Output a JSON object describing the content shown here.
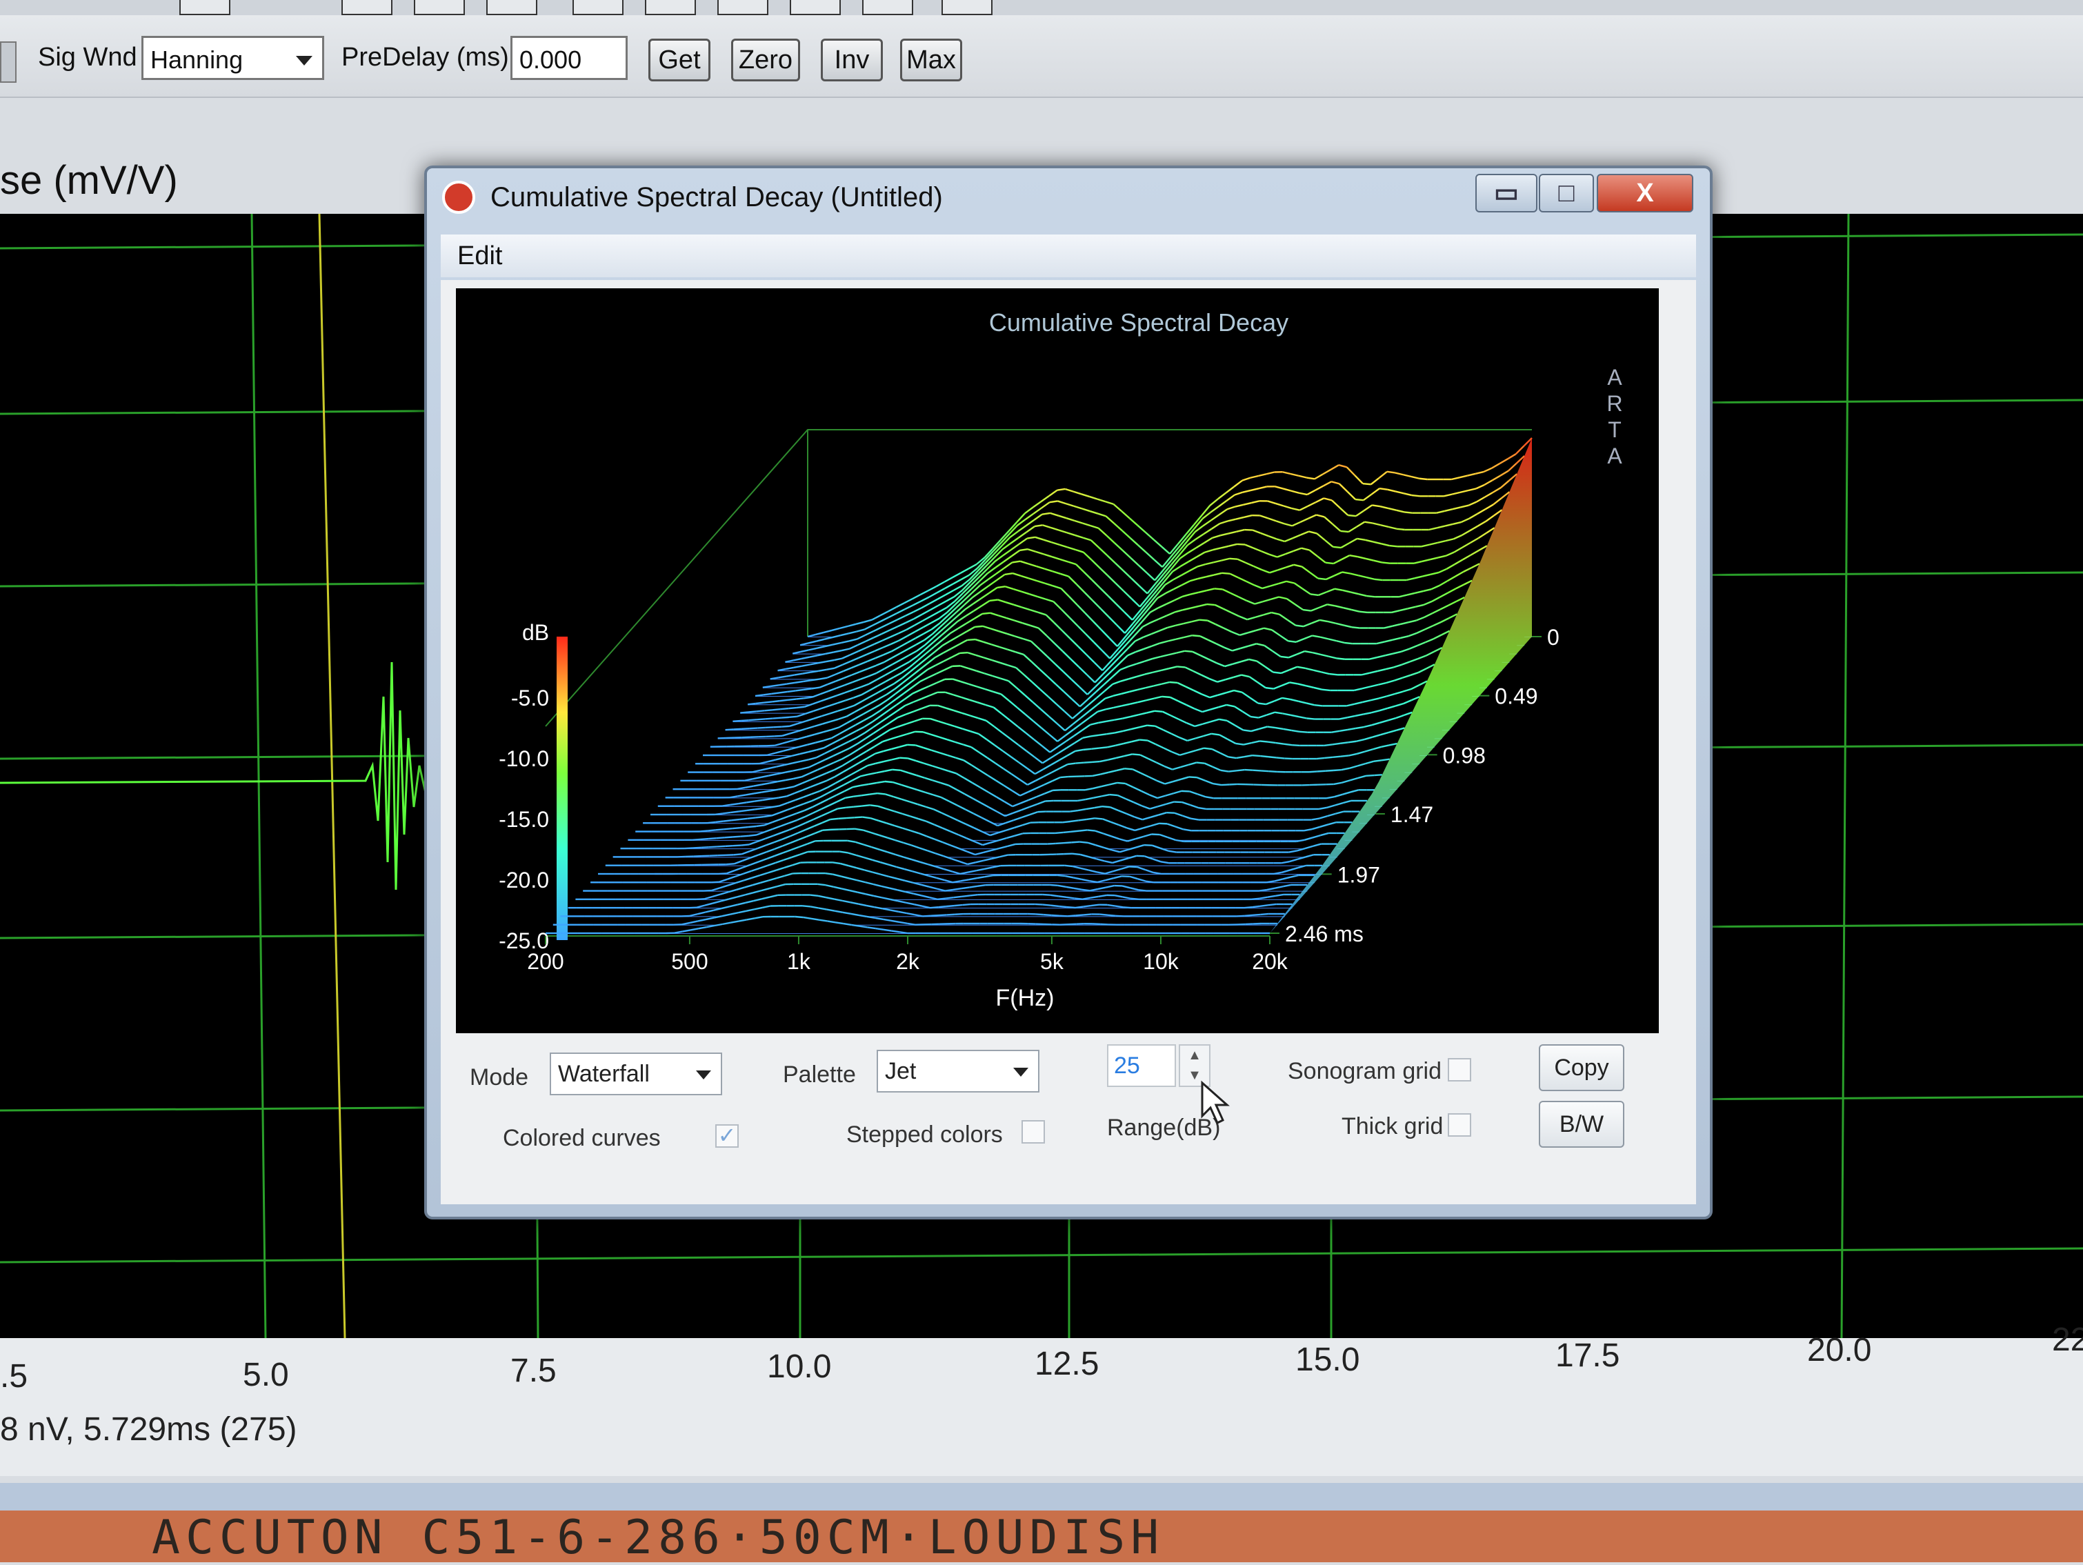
{
  "host": {
    "toolbar": {
      "sig_wnd_label": "Sig Wnd",
      "sig_wnd_value": "Hanning",
      "predelay_label": "PreDelay (ms)",
      "predelay_value": "0.000",
      "buttons": [
        "Get",
        "Zero",
        "Inv",
        "Max"
      ]
    },
    "plot_title": "se (mV/V)",
    "x_ticks": [
      ".5",
      "5.0",
      "7.5",
      "10.0",
      "12.5",
      "15.0",
      "17.5",
      "20.0",
      "22"
    ],
    "readout": "8 nV, 5.729ms (275)",
    "note": "ACCUTON C51-6-286·50CM·LOUDISH"
  },
  "window": {
    "title": "Cumulative Spectral Decay  (Untitled)",
    "menu": [
      "Edit"
    ],
    "controls": {
      "minimize_glyph": "▭",
      "maximize_glyph": "□",
      "close_glyph": "X"
    }
  },
  "chart_data": {
    "type": "area",
    "title": "Cumulative Spectral Decay",
    "xlabel": "F(Hz)",
    "ylabel": "dB",
    "zlabel": "ms",
    "watermark": "ARTA",
    "x_ticks": [
      "200",
      "500",
      "1k",
      "2k",
      "5k",
      "10k",
      "20k"
    ],
    "y_ticks": [
      "-5.0",
      "-10.0",
      "-15.0",
      "-20.0",
      "-25.0"
    ],
    "z_ticks": [
      "0",
      "0.49",
      "0.98",
      "1.47",
      "1.97",
      "2.46 ms"
    ],
    "xlim": [
      200,
      20000
    ],
    "ylim": [
      -25,
      0
    ],
    "zlim": [
      0,
      2.46
    ],
    "x_scale": "log",
    "series": [
      {
        "t_ms": 0.0,
        "freq": [
          200,
          300,
          450,
          600,
          800,
          1000,
          1400,
          2000,
          2600,
          3200,
          4000,
          5000,
          6000,
          7000,
          8000,
          10000,
          12000,
          15000,
          18000,
          20000
        ],
        "db": [
          -25,
          -23,
          -19,
          -16,
          -10,
          -7,
          -9,
          -15,
          -9,
          -6,
          -5,
          -6,
          -4,
          -7,
          -5,
          -6,
          -6,
          -5,
          -3,
          -1
        ]
      },
      {
        "t_ms": 0.49,
        "freq": [
          200,
          300,
          450,
          600,
          800,
          1000,
          1400,
          2000,
          2600,
          3200,
          4000,
          5000,
          6000,
          7000,
          8000,
          10000,
          12000,
          15000,
          18000,
          20000
        ],
        "db": [
          -25,
          -24,
          -21,
          -18,
          -13,
          -10,
          -12,
          -19,
          -13,
          -11,
          -10,
          -12,
          -11,
          -13,
          -12,
          -13,
          -13,
          -12,
          -10,
          -9
        ]
      },
      {
        "t_ms": 0.98,
        "freq": [
          200,
          300,
          450,
          600,
          800,
          1000,
          1400,
          2000,
          2600,
          3200,
          4000,
          5000,
          6000,
          7000,
          8000,
          10000,
          12000,
          15000,
          18000,
          20000
        ],
        "db": [
          -25,
          -25,
          -23,
          -20,
          -16,
          -14,
          -16,
          -22,
          -18,
          -17,
          -16,
          -18,
          -17,
          -19,
          -18,
          -19,
          -19,
          -18,
          -17,
          -16
        ]
      },
      {
        "t_ms": 1.47,
        "freq": [
          200,
          300,
          450,
          600,
          800,
          1000,
          1400,
          2000,
          2600,
          3200,
          4000,
          5000,
          6000,
          7000,
          8000,
          10000,
          12000,
          15000,
          18000,
          20000
        ],
        "db": [
          -25,
          -25,
          -24,
          -22,
          -19,
          -18,
          -20,
          -24,
          -22,
          -22,
          -21,
          -23,
          -22,
          -23,
          -23,
          -23,
          -23,
          -23,
          -22,
          -22
        ]
      },
      {
        "t_ms": 1.97,
        "freq": [
          200,
          300,
          450,
          600,
          800,
          1000,
          1400,
          2000,
          2600,
          3200,
          4000,
          5000,
          6000,
          7000,
          8000,
          10000,
          12000,
          15000,
          18000,
          20000
        ],
        "db": [
          -25,
          -25,
          -25,
          -23,
          -21,
          -21,
          -23,
          -25,
          -24,
          -24,
          -24,
          -25,
          -24,
          -25,
          -25,
          -25,
          -25,
          -25,
          -24,
          -24
        ]
      },
      {
        "t_ms": 2.46,
        "freq": [
          200,
          300,
          450,
          600,
          800,
          1000,
          1400,
          2000,
          2600,
          3200,
          4000,
          5000,
          6000,
          7000,
          8000,
          10000,
          12000,
          15000,
          18000,
          20000
        ],
        "db": [
          -25,
          -25,
          -25,
          -24,
          -23,
          -23,
          -24,
          -25,
          -25,
          -25,
          -25,
          -25,
          -25,
          -25,
          -25,
          -25,
          -25,
          -25,
          -25,
          -25
        ]
      }
    ],
    "colors": {
      "low": "#3c8cff",
      "mid": "#3cff8c",
      "high": "#ff3020"
    }
  },
  "panel": {
    "mode_label": "Mode",
    "mode_value": "Waterfall",
    "palette_label": "Palette",
    "palette_value": "Jet",
    "range_value": "25",
    "range_label": "Range(dB)",
    "colored_curves_label": "Colored curves",
    "colored_curves_checked": true,
    "stepped_colors_label": "Stepped colors",
    "stepped_colors_checked": false,
    "sonogram_grid_label": "Sonogram grid",
    "thick_grid_label": "Thick grid",
    "copy_label": "Copy",
    "bw_label": "B/W",
    "check_glyph": "✓"
  }
}
